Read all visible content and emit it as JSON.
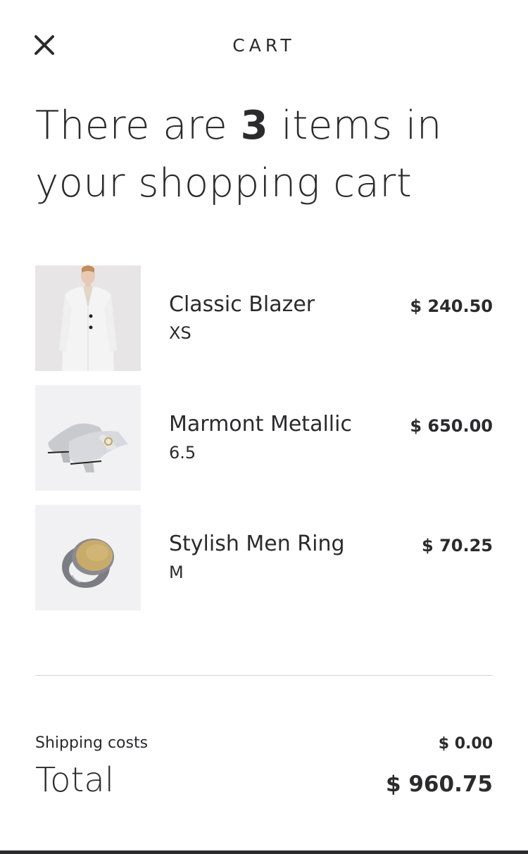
{
  "header": {
    "title": "CART",
    "close_icon": "close-icon"
  },
  "headline": {
    "prefix": "There are ",
    "count": "3",
    "suffix": " items in your shopping cart"
  },
  "items": [
    {
      "name": "Classic Blazer",
      "variant": "XS",
      "price": "$ 240.50",
      "image": "blazer-image"
    },
    {
      "name": "Marmont Metallic",
      "variant": "6.5",
      "price": "$ 650.00",
      "image": "shoes-image"
    },
    {
      "name": "Stylish Men Ring",
      "variant": "M",
      "price": "$ 70.25",
      "image": "ring-image"
    }
  ],
  "summary": {
    "shipping_label": "Shipping costs",
    "shipping_value": "$ 0.00",
    "total_label": "Total",
    "total_value": "$ 960.75"
  },
  "colors": {
    "text": "#2b2b2e",
    "background": "#ffffff",
    "thumb_bg": "#f1f1f3"
  }
}
